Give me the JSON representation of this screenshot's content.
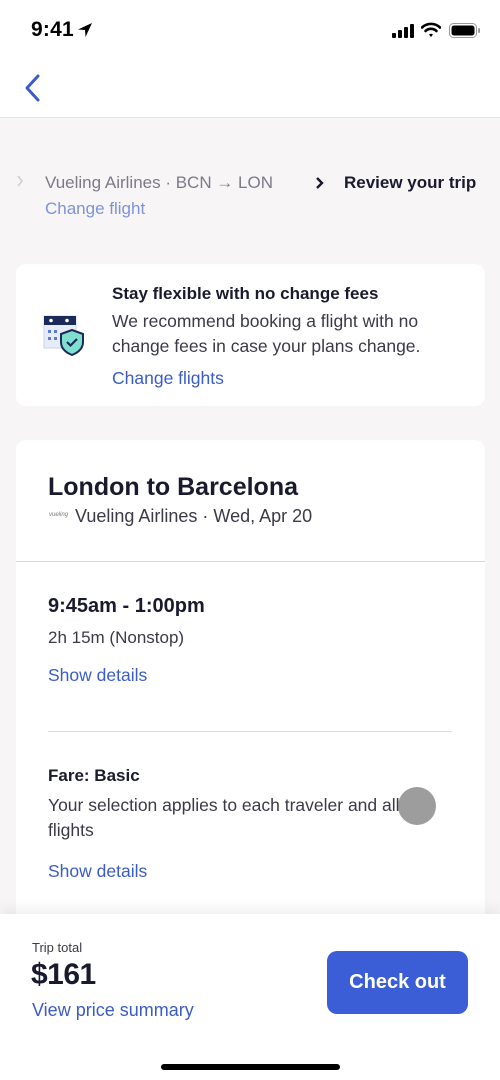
{
  "status_bar": {
    "time": "9:41",
    "icons": [
      "location-arrow-icon",
      "signal-icon",
      "wifi-icon",
      "battery-icon"
    ]
  },
  "nav": {
    "back_icon": "chevron-left-icon"
  },
  "breadcrumb": {
    "previous": "Vueling Airlines · BCN → LON",
    "current": "Review your trip",
    "change_link": "Change flight"
  },
  "flex_card": {
    "icon": "calendar-shield-icon",
    "title": "Stay flexible with no change fees",
    "description": "We recommend booking a flight with no change fees in case your plans change.",
    "link": "Change flights"
  },
  "trip": {
    "title": "London to Barcelona",
    "airline_logo": "vueling",
    "subtitle": "Vueling Airlines · Wed, Apr 20",
    "time_range": "9:45am - 1:00pm",
    "duration": "2h 15m (Nonstop)",
    "show_details_1": "Show details",
    "fare_title": "Fare: Basic",
    "fare_description": "Your selection applies to each traveler and all flights",
    "show_details_2": "Show details"
  },
  "footer": {
    "trip_total_label": "Trip total",
    "trip_total": "$161",
    "price_summary_link": "View price summary",
    "checkout_label": "Check out"
  },
  "colors": {
    "accent": "#3b5ed6",
    "link": "#3b5cc8",
    "text_primary": "#1a1a2e",
    "background": "#f8f5f7"
  }
}
